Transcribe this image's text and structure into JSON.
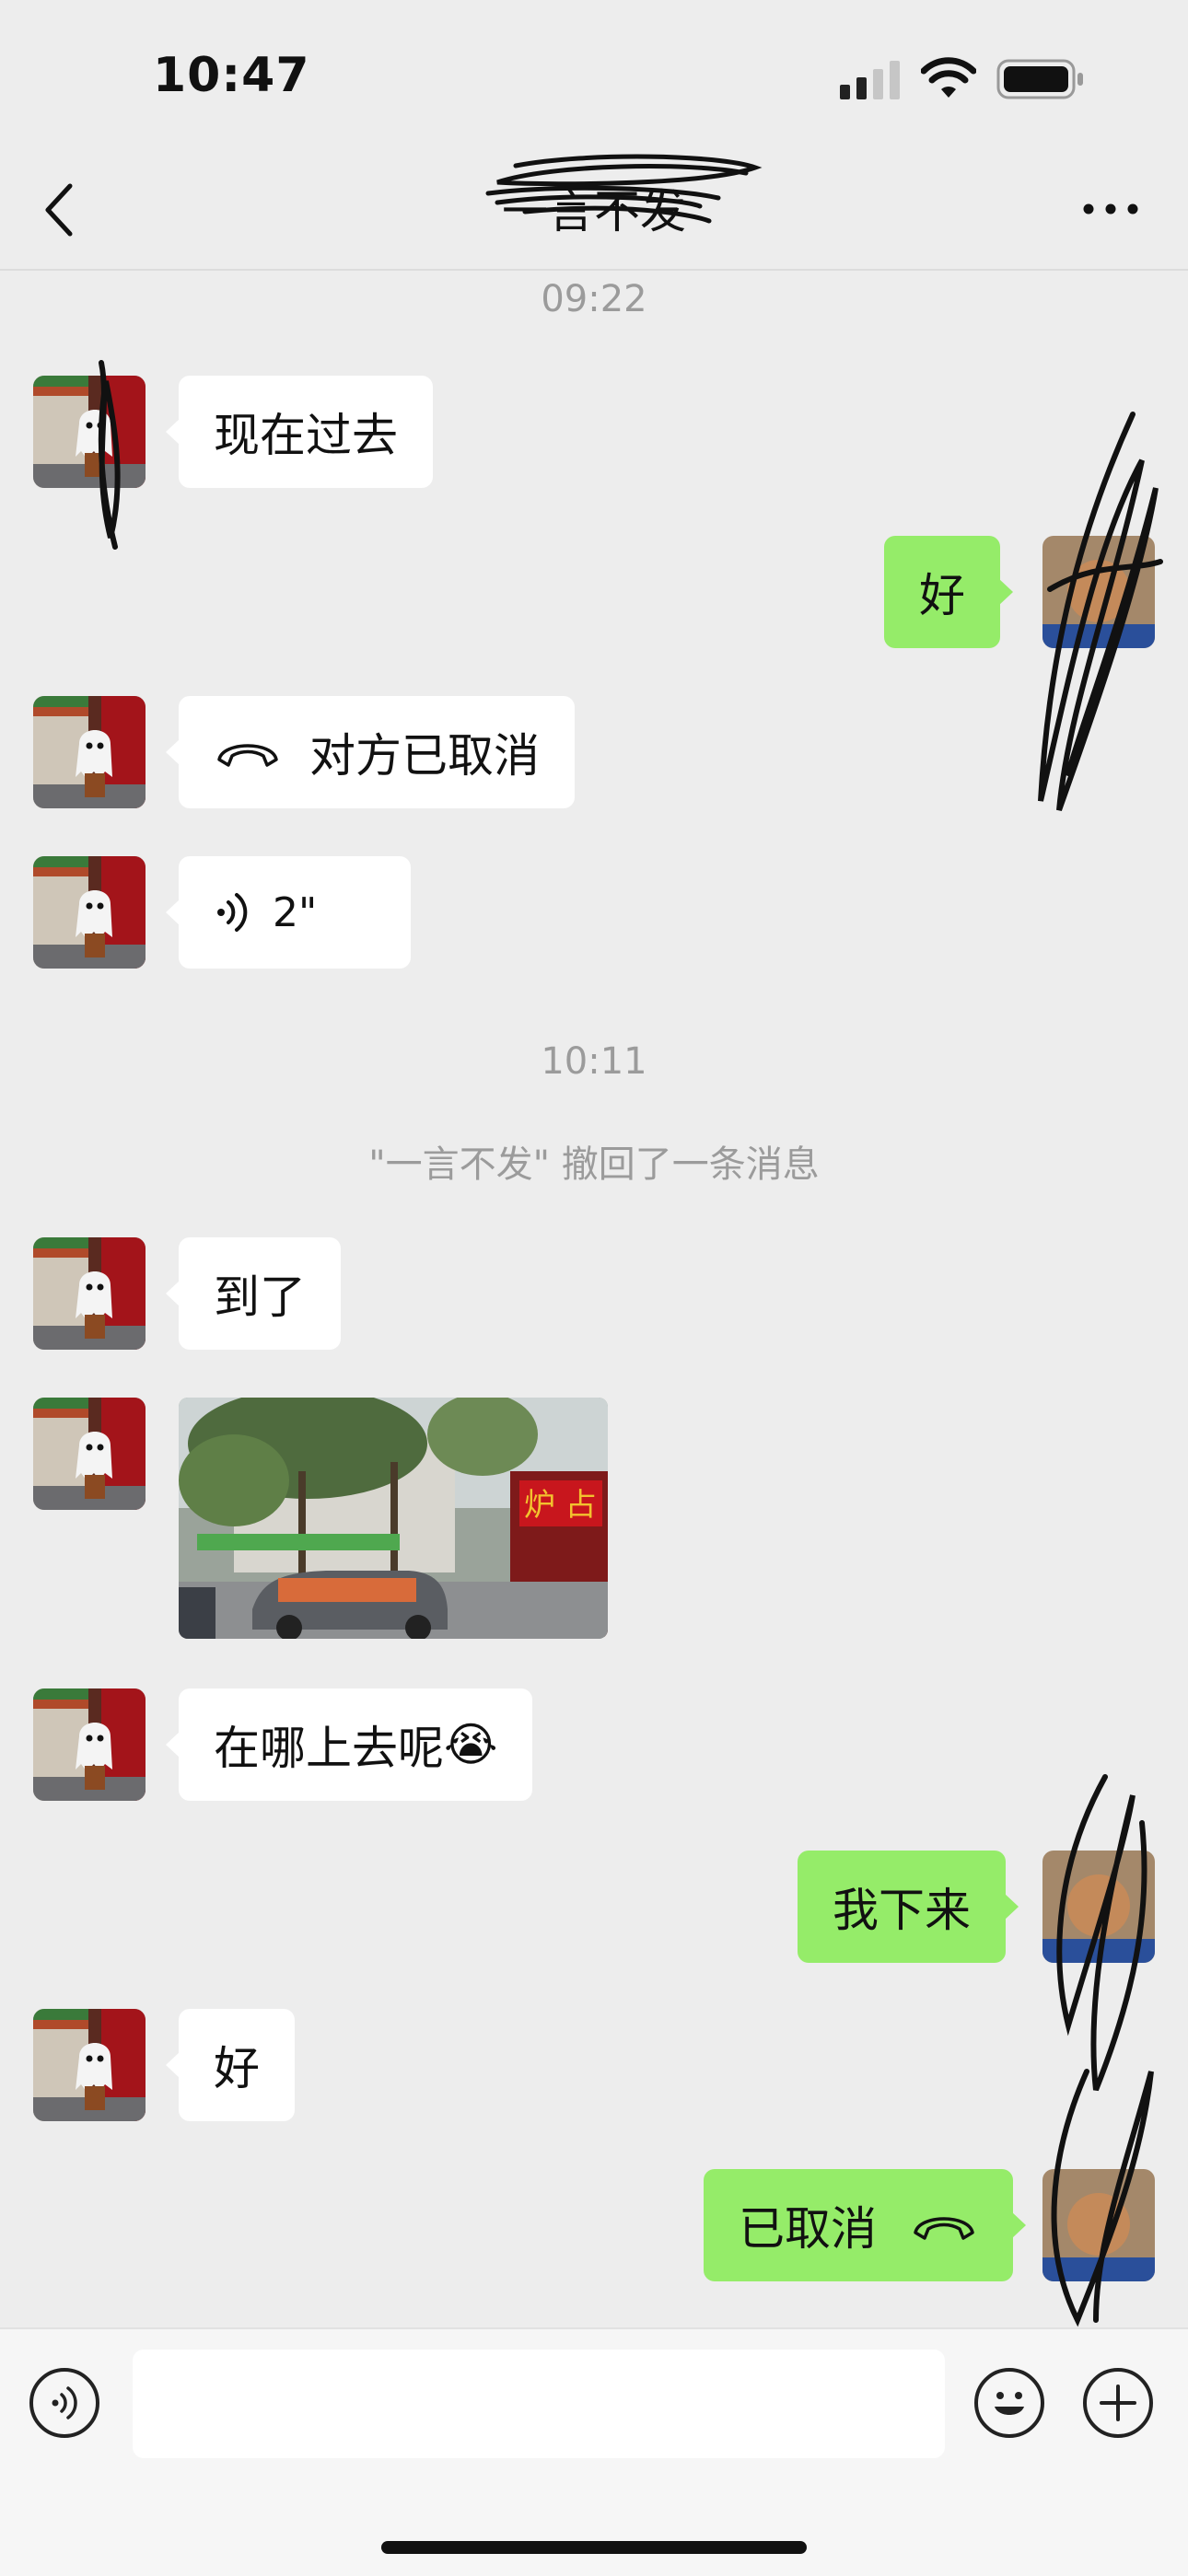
{
  "status_bar": {
    "time": "10:47"
  },
  "nav": {
    "title": "一言不发"
  },
  "messages": {
    "ts1": "09:22",
    "m1": "现在过去",
    "m2": "好",
    "m3": "对方已取消",
    "m4": "2\"",
    "ts2": "10:11",
    "recall": "\"一言不发\" 撤回了一条消息",
    "m5": "到了",
    "m7": "在哪上去呢",
    "m7_emoji": "😭",
    "m8": "我下来",
    "m9": "好",
    "m10": "已取消"
  },
  "input_bar": {
    "placeholder": ""
  },
  "colors": {
    "background": "#ededed",
    "sent_bubble": "#95ec69",
    "received_bubble": "#ffffff"
  }
}
